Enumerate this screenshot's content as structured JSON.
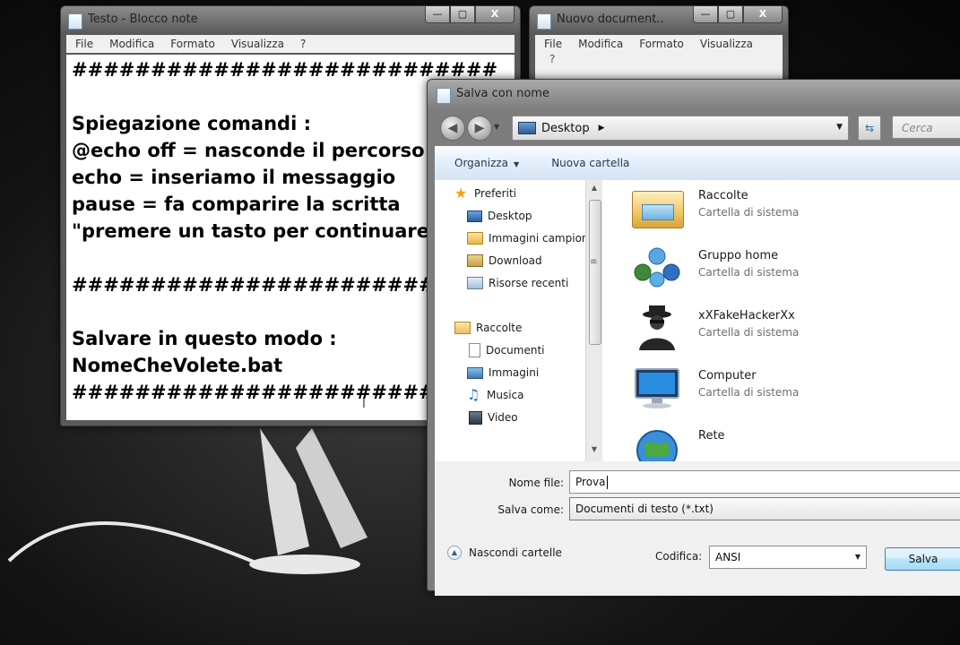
{
  "notepad": {
    "title": "Testo - Blocco note",
    "menu": [
      "File",
      "Modifica",
      "Formato",
      "Visualizza",
      "?"
    ],
    "lines": [
      "###########################",
      "",
      "Spiegazione comandi :",
      "@echo off = nasconde il percorso",
      "echo = inseriamo il messaggio",
      "pause = fa comparire la scritta",
      "\"premere un tasto per continuare\"",
      "",
      "###########################",
      "",
      "Salvare in questo modo :",
      "NomeCheVolete.bat",
      "###########################"
    ]
  },
  "nuovo_documento": {
    "title": "Nuovo document...",
    "menu": [
      "File",
      "Modifica",
      "Formato",
      "Visualizza"
    ],
    "menu_wrap": "?"
  },
  "caption_buttons": {
    "minimize": "—",
    "maximize": "▢",
    "close": "X"
  },
  "save_dialog": {
    "title": "Salva con nome",
    "address": "Desktop",
    "search_placeholder": "Cerca Desktop",
    "toolbar": {
      "organize": "Organizza",
      "new_folder": "Nuova cartella"
    },
    "nav": {
      "favorites_header": "Preferiti",
      "favorites": [
        "Desktop",
        "Immagini campione",
        "Download",
        "Risorse recenti"
      ],
      "libraries_header": "Raccolte",
      "libraries": [
        "Documenti",
        "Immagini",
        "Musica",
        "Video"
      ]
    },
    "files": [
      {
        "name": "Raccolte",
        "type": "Cartella di sistema",
        "icon": "library-icon"
      },
      {
        "name": "Gruppo home",
        "type": "Cartella di sistema",
        "icon": "homegroup-icon"
      },
      {
        "name": "xXFakeHackerXx",
        "type": "Cartella di sistema",
        "icon": "user-hacker-icon"
      },
      {
        "name": "Computer",
        "type": "Cartella di sistema",
        "icon": "computer-icon"
      },
      {
        "name": "Rete",
        "type": "",
        "icon": "network-icon"
      }
    ],
    "filename_label": "Nome file:",
    "filename_value": "Prova",
    "savetype_label": "Salva come:",
    "savetype_value": "Documenti di testo (*.txt)",
    "hide_folders": "Nascondi cartelle",
    "encoding_label": "Codifica:",
    "encoding_value": "ANSI",
    "save_button": "Salva"
  },
  "colors": {
    "accent": "#3c7fb1",
    "toolbar_bg": "#e3eef9",
    "desktop_bg": "#141414"
  }
}
